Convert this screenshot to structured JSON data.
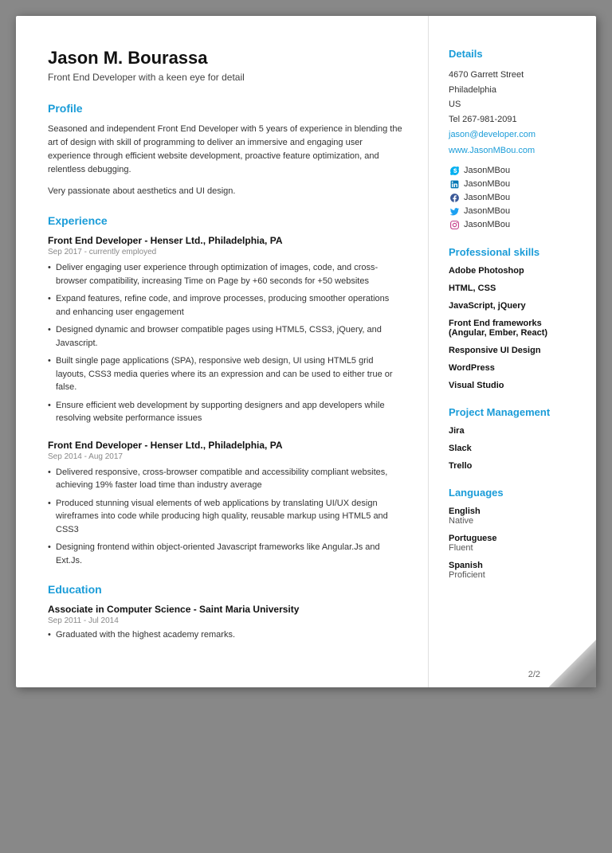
{
  "page": {
    "number": "2/2"
  },
  "header": {
    "name": "Jason M. Bourassa",
    "title": "Front End Developer with a keen eye for detail"
  },
  "profile": {
    "section_title": "Profile",
    "text1": "Seasoned and independent Front End Developer with 5 years of experience in blending the art of design with skill of programming to deliver an immersive and engaging user experience through efficient website development, proactive feature optimization, and relentless debugging.",
    "text2": "Very passionate about aesthetics and UI design."
  },
  "experience": {
    "section_title": "Experience",
    "jobs": [
      {
        "company": "Front End Developer - Henser Ltd., Philadelphia, PA",
        "date": "Sep 2017 - currently employed",
        "bullets": [
          "Deliver engaging user experience through optimization of images, code, and cross-browser compatibility, increasing Time on Page by +60 seconds for +50 websites",
          "Expand features, refine code, and improve processes, producing smoother operations and enhancing user engagement",
          "Designed dynamic and browser compatible pages using HTML5, CSS3, jQuery, and Javascript.",
          "Built single page applications (SPA), responsive web design, UI using HTML5 grid layouts, CSS3 media queries where its an expression and can be used to either true or false.",
          "Ensure efficient web development by supporting designers and app developers while resolving website performance issues"
        ]
      },
      {
        "company": "Front End Developer - Henser Ltd., Philadelphia, PA",
        "date": "Sep 2014 - Aug 2017",
        "bullets": [
          "Delivered responsive, cross-browser compatible and accessibility compliant websites, achieving 19% faster load time than industry average",
          "Produced stunning visual elements of web applications by translating UI/UX design wireframes into code while producing high quality, reusable markup using HTML5 and CSS3",
          "Designing frontend within object-oriented Javascript frameworks like Angular.Js and Ext.Js."
        ]
      }
    ]
  },
  "education": {
    "section_title": "Education",
    "degree": "Associate in Computer Science - Saint Maria University",
    "date": "Sep 2011 - Jul 2014",
    "bullets": [
      "Graduated with the highest academy remarks."
    ]
  },
  "details": {
    "section_title": "Details",
    "address_line1": "4670 Garrett Street",
    "address_line2": "Philadelphia",
    "address_line3": "US",
    "phone": "Tel 267-981-2091",
    "email": "jason@developer.com",
    "website": "www.JasonMBou.com",
    "socials": [
      {
        "icon": "skype",
        "label": "JasonMBou"
      },
      {
        "icon": "linkedin",
        "label": "JasonMBou"
      },
      {
        "icon": "facebook",
        "label": "JasonMBou"
      },
      {
        "icon": "twitter",
        "label": "JasonMBou"
      },
      {
        "icon": "instagram",
        "label": "JasonMBou"
      }
    ]
  },
  "skills": {
    "section_title": "Professional skills",
    "items": [
      "Adobe Photoshop",
      "HTML, CSS",
      "JavaScript, jQuery",
      "Front End frameworks (Angular, Ember, React)",
      "Responsive UI Design",
      "WordPress",
      "Visual Studio"
    ]
  },
  "project_management": {
    "section_title": "Project Management",
    "items": [
      "Jira",
      "Slack",
      "Trello"
    ]
  },
  "languages": {
    "section_title": "Languages",
    "items": [
      {
        "name": "English",
        "level": "Native"
      },
      {
        "name": "Portuguese",
        "level": "Fluent"
      },
      {
        "name": "Spanish",
        "level": "Proficient"
      }
    ]
  }
}
